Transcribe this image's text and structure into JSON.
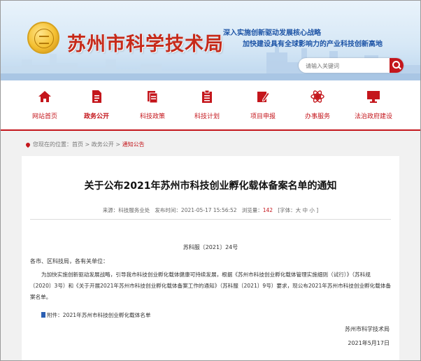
{
  "header": {
    "site_title": "苏州市科学技术局",
    "slogan_line1": "深入实施创新驱动发展核心战略",
    "slogan_line2": "加快建设具有全球影响力的产业科技创新高地",
    "search_placeholder": "请输入关键词"
  },
  "nav": {
    "items": [
      {
        "label": "网站首页",
        "icon": "home-icon"
      },
      {
        "label": "政务公开",
        "icon": "document-icon"
      },
      {
        "label": "科技政策",
        "icon": "policy-icon"
      },
      {
        "label": "科技计划",
        "icon": "plan-icon"
      },
      {
        "label": "项目申报",
        "icon": "edit-icon"
      },
      {
        "label": "办事服务",
        "icon": "service-icon"
      },
      {
        "label": "法治政府建设",
        "icon": "monitor-icon"
      }
    ],
    "active_index": 1
  },
  "breadcrumb": {
    "prefix": "您现在的位置：",
    "items": [
      "首页",
      "政务公开",
      "通知公告"
    ],
    "separator": " > "
  },
  "article": {
    "title": "关于公布2021年苏州市科技创业孵化载体备案名单的通知",
    "source": "来源：科技服务业处",
    "publish_time": "发布时间：2021-05-17 15:56:52",
    "views_label": "浏览量：",
    "views": "142",
    "font_size_label": "[字体：大 中 小 ]",
    "doc_number": "苏科服〔2021〕24号",
    "greeting": "各市、区科技局，各有关单位：",
    "body": "为加快实施创新驱动发展战略，引导我市科技创业孵化载体健康可持续发展，根据《苏州市科技创业孵化载体管理实施细则（试行）》（苏科规〔2020〕3号）和《关于开展2021年苏州市科技创业孵化载体备案工作的通知》（苏科服〔2021〕9号）要求，现公布2021年苏州市科技创业孵化载体备案名单。",
    "attachment": "附件：2021年苏州市科技创业孵化载体名单",
    "signature": "苏州市科学技术局",
    "date": "2021年5月17日"
  },
  "colors": {
    "accent_red": "#c4161c",
    "slogan_blue": "#1d54a6"
  }
}
